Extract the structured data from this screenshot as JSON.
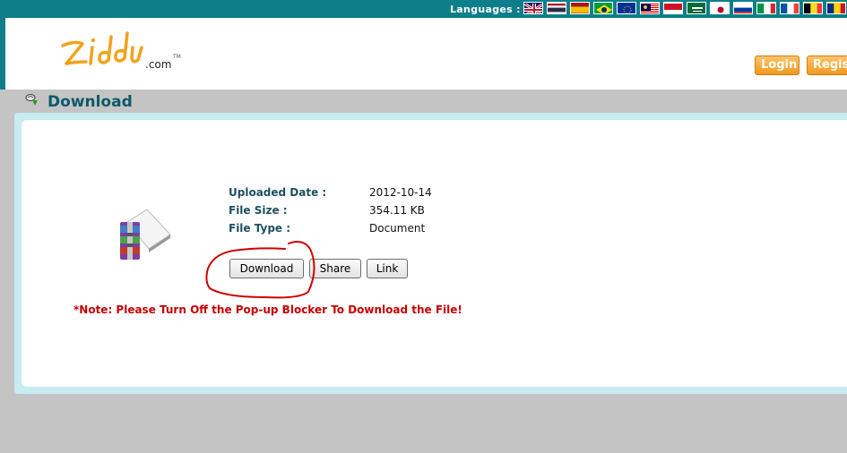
{
  "top_bar": {
    "languages_label": "Languages :",
    "flags": [
      "flag-uk-icon",
      "flag-thailand-icon",
      "flag-spain-icon",
      "flag-brazil-icon",
      "flag-eu-icon",
      "flag-malaysia-icon",
      "flag-indonesia-icon",
      "flag-saudi-arabia-icon",
      "flag-japan-icon",
      "flag-russia-icon",
      "flag-italy-icon",
      "flag-france-icon",
      "flag-belgium-icon",
      "flag-romania-icon"
    ]
  },
  "header": {
    "logo_text": "ziddu",
    "logo_suffix": ".com",
    "logo_tm": "TM",
    "login_label": "Login",
    "register_label": "Regis"
  },
  "section": {
    "title": "Download"
  },
  "file": {
    "uploaded_label": "Uploaded Date :",
    "uploaded_value": "2012-10-14",
    "size_label": "File Size :",
    "size_value": "354.11 KB",
    "type_label": "File Type :",
    "type_value": "Document"
  },
  "buttons": {
    "download": "Download",
    "share": "Share",
    "link": "Link"
  },
  "note": "*Note: Please Turn Off the Pop-up Blocker To Download the File!",
  "colors": {
    "teal": "#0e7f8a",
    "orange": "#f09a1c",
    "label": "#1e4f63",
    "note": "#c80000",
    "annotation": "#d00000"
  }
}
